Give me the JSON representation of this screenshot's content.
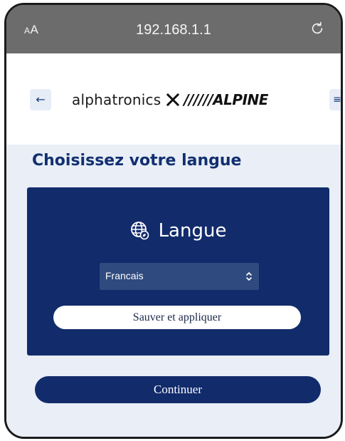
{
  "browser": {
    "text_size_label_small": "A",
    "text_size_label_large": "A",
    "url": "192.168.1.1",
    "reload_icon": "reload-icon"
  },
  "header": {
    "back_icon": "←",
    "logo_left": "alphatronics",
    "logo_right": "//////ALPINE",
    "menu_icon": "≡"
  },
  "page": {
    "title": "Choisissez votre langue"
  },
  "language_card": {
    "title": "Langue",
    "icon": "globe-icon",
    "select_value": "Francais",
    "save_label": "Sauver et appliquer"
  },
  "footer": {
    "continue_label": "Continuer"
  },
  "colors": {
    "brand_navy": "#112b6b",
    "title_navy": "#123070",
    "content_bg": "#e9eef7",
    "browser_bar": "#6c6c6c"
  }
}
